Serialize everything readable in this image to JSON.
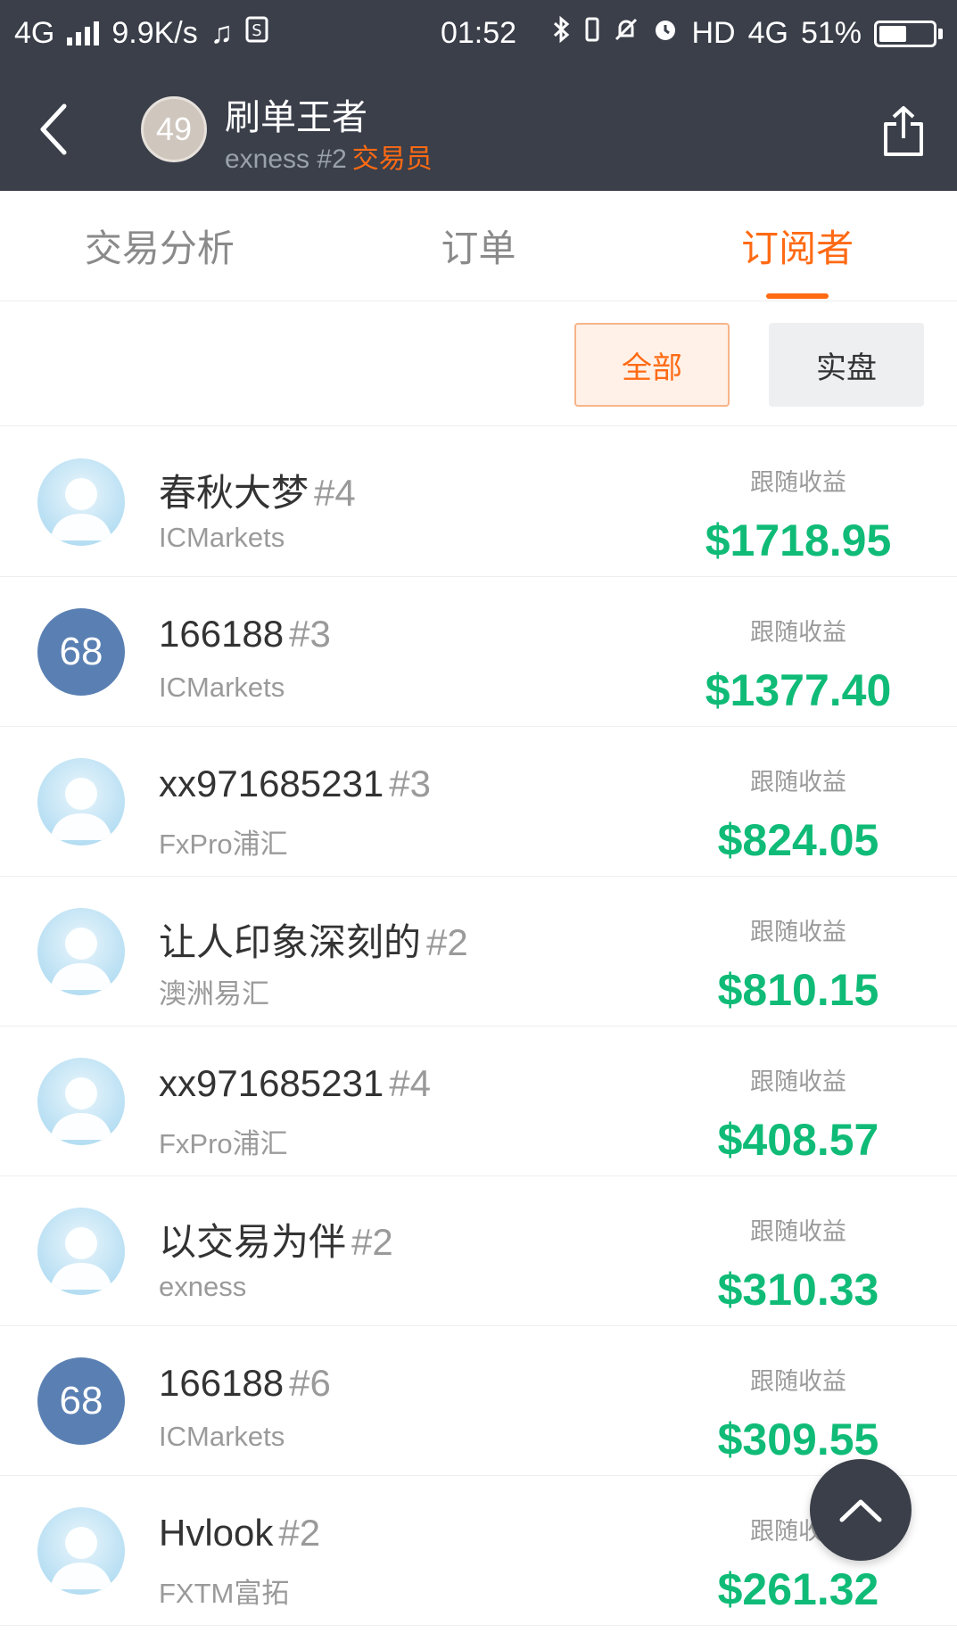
{
  "status_bar": {
    "network": "4G",
    "speed": "9.9K/s",
    "time": "01:52",
    "hd_label": "HD",
    "network_right": "4G",
    "battery": "51%"
  },
  "header": {
    "back_icon": "chevron-left-icon",
    "avatar_level": "49",
    "title": "刷单王者",
    "subtitle": "exness #2",
    "role": "交易员",
    "share_icon": "share-icon"
  },
  "tabs": [
    {
      "label": "交易分析",
      "active": false
    },
    {
      "label": "订单",
      "active": false
    },
    {
      "label": "订阅者",
      "active": true
    }
  ],
  "filters": {
    "all_label": "全部",
    "live_label": "实盘"
  },
  "subscribers": [
    {
      "name": "春秋大梦",
      "rank": "#4",
      "broker": "ICMarkets",
      "avatar_type": "default",
      "profit_label": "跟随收益",
      "profit": "$1718.95"
    },
    {
      "name": "166188",
      "rank": "#3",
      "broker": "ICMarkets",
      "avatar_type": "level",
      "avatar_text": "68",
      "profit_label": "跟随收益",
      "profit": "$1377.40"
    },
    {
      "name": "xx971685231",
      "rank": "#3",
      "broker": "FxPro浦汇",
      "avatar_type": "default",
      "profit_label": "跟随收益",
      "profit": "$824.05"
    },
    {
      "name": "让人印象深刻的",
      "rank": "#2",
      "broker": "澳洲易汇",
      "avatar_type": "default",
      "profit_label": "跟随收益",
      "profit": "$810.15"
    },
    {
      "name": "xx971685231",
      "rank": "#4",
      "broker": "FxPro浦汇",
      "avatar_type": "default",
      "profit_label": "跟随收益",
      "profit": "$408.57"
    },
    {
      "name": "以交易为伴",
      "rank": "#2",
      "broker": "exness",
      "avatar_type": "default",
      "profit_label": "跟随收益",
      "profit": "$310.33"
    },
    {
      "name": "166188",
      "rank": "#6",
      "broker": "ICMarkets",
      "avatar_type": "level",
      "avatar_text": "68",
      "profit_label": "跟随收益",
      "profit": "$309.55"
    },
    {
      "name": "Hvlook",
      "rank": "#2",
      "broker": "FXTM富拓",
      "avatar_type": "default",
      "profit_label": "跟随收益",
      "profit": "$261.32"
    }
  ],
  "fab_icon": "chevron-up-icon",
  "colors": {
    "header_bg": "#3a3f4a",
    "accent": "#ff6a13",
    "profit": "#0fbb77",
    "level_avatar": "#5a80b3"
  }
}
